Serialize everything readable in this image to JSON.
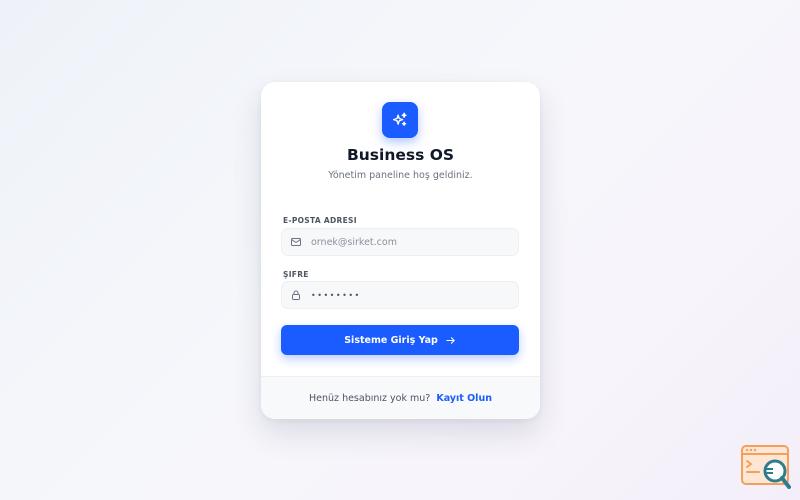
{
  "brand": {
    "logo_icon": "sparkles-icon",
    "title": "Business OS",
    "subtitle": "Yönetim paneline hoş geldiniz."
  },
  "form": {
    "email": {
      "label": "E-POSTA ADRESI",
      "placeholder": "ornek@sirket.com",
      "icon": "mail-icon"
    },
    "password": {
      "label": "ŞIFRE",
      "masked_value": "••••••••",
      "icon": "lock-icon"
    },
    "submit_label": "Sisteme Giriş Yap",
    "submit_icon": "arrow-right-icon"
  },
  "footer": {
    "prompt": "Henüz hesabınız yok mu?",
    "link_label": "Kayıt Olun"
  },
  "colors": {
    "primary": "#1a5cff",
    "badge_orange": "#f4a05b",
    "badge_teal": "#2f7d8c"
  },
  "corner_badge_icon": "search-extension-icon"
}
